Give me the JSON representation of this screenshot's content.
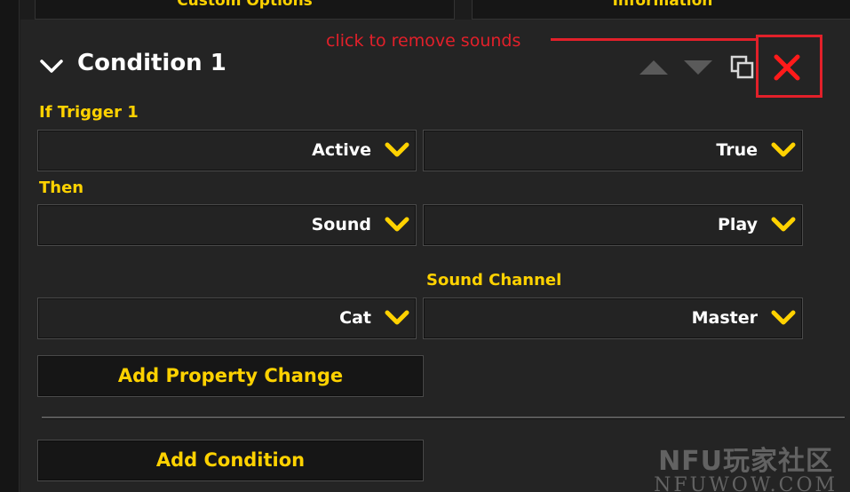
{
  "tabs": [
    {
      "label": "Custom Options"
    },
    {
      "label": "Information"
    }
  ],
  "condition": {
    "title": "Condition 1"
  },
  "annotation": {
    "text": "click to remove sounds",
    "color": "#e2202a"
  },
  "icons": {
    "collapse": "chevron-down-icon",
    "move_up": "triangle-up-icon",
    "move_down": "triangle-down-icon",
    "duplicate": "duplicate-icon",
    "delete": "close-x-icon"
  },
  "if_section": {
    "label": "If Trigger 1",
    "left_value": "Active",
    "right_value": "True"
  },
  "then_section": {
    "label": "Then",
    "left_value": "Sound",
    "right_value": "Play"
  },
  "sound_channel": {
    "label": "Sound Channel",
    "left_value": "Cat",
    "right_value": "Master"
  },
  "buttons": {
    "add_property_change": "Add Property Change",
    "add_condition": "Add Condition"
  },
  "watermark": {
    "top": "NFU玩家社区",
    "bottom": "NFUWOW.COM"
  },
  "colors": {
    "accent": "#ffd200",
    "background": "#242424",
    "delete": "#e2202a"
  }
}
